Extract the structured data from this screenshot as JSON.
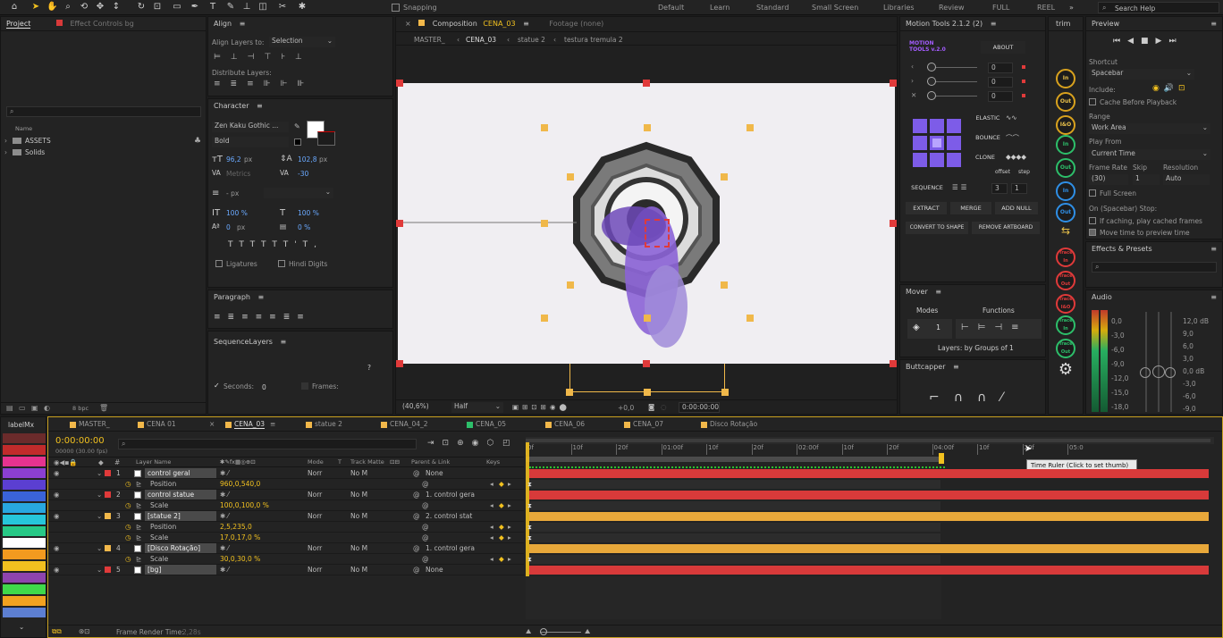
{
  "toolbar": {
    "snapping": "Snapping",
    "workspaces": [
      "Default",
      "Learn",
      "Standard",
      "Small Screen",
      "Libraries",
      "Review",
      "FULL",
      "REEL"
    ],
    "search": "Search Help"
  },
  "project": {
    "tab": "Project",
    "tab2": "Effect Controls bg",
    "col_name": "Name",
    "items": [
      "ASSETS",
      "Solids"
    ],
    "bpc": "8 bpc"
  },
  "align": {
    "title": "Align",
    "align_to_label": "Align Layers to:",
    "align_to_value": "Selection",
    "distribute": "Distribute Layers:"
  },
  "character": {
    "title": "Character",
    "font": "Zen Kaku Gothic ...",
    "style": "Bold",
    "size": "96,2",
    "size_unit": "px",
    "leading": "102,8",
    "leading_unit": "px",
    "kerning": "Metrics",
    "tracking": "-30",
    "stroke": "- px",
    "vscale": "100 %",
    "hscale": "100 %",
    "baseline": "0",
    "baseline_unit": "px",
    "tsume": "0 %",
    "ligatures": "Ligatures",
    "hindi": "Hindi Digits"
  },
  "paragraph": {
    "title": "Paragraph"
  },
  "sequence": {
    "title": "SequenceLayers",
    "seconds": "Seconds:",
    "seconds_value": "0",
    "frames": "Frames:",
    "help": "?"
  },
  "composition": {
    "tab": "Composition",
    "name": "CENA_03",
    "footage": "Footage (none)",
    "crumbs": [
      "MASTER_",
      "CENA_03",
      "statue 2",
      "testura tremula 2"
    ],
    "zoom": "(40,6%)",
    "res": "Half",
    "exposure": "+0,0",
    "time": "0:00:00:00"
  },
  "motion_tools": {
    "title": "Motion Tools 2.1.2 (2)",
    "logo": "MOTION TOOLS v.2.0",
    "about": "ABOUT",
    "fields": [
      "0",
      "0",
      "0"
    ],
    "elastic": "ELASTIC",
    "bounce": "BOUNCE",
    "clone": "CLONE",
    "offset": "offset",
    "step": "step",
    "sequence": "SEQUENCE",
    "seq_vals": [
      "3",
      "1"
    ],
    "extract": "EXTRACT",
    "merge": "MERGE",
    "add_null": "ADD NULL",
    "convert": "CONVERT TO SHAPE",
    "remove": "REMOVE ARTBOARD"
  },
  "mover": {
    "title": "Mover",
    "modes": "Modes",
    "functions": "Functions",
    "mode_value": "1",
    "status": "Layers: by Groups of 1"
  },
  "buttcapper": {
    "title": "Buttcapper"
  },
  "trim": {
    "title": "trim",
    "buttons": [
      "In",
      "Out",
      "I&O",
      "In",
      "Out",
      "In",
      "Out",
      "Trace In",
      "Trace Out",
      "Trace I&O",
      "Trace In",
      "Trace Out"
    ]
  },
  "preview": {
    "title": "Preview",
    "shortcut_label": "Shortcut",
    "shortcut": "Spacebar",
    "include": "Include:",
    "cache": "Cache Before Playback",
    "range_label": "Range",
    "range": "Work Area",
    "play_from_label": "Play From",
    "play_from": "Current Time",
    "frame_rate": "Frame Rate",
    "skip": "Skip",
    "resolution": "Resolution",
    "fr_value": "(30)",
    "skip_value": "1",
    "res_value": "Auto",
    "full_screen": "Full Screen",
    "stop_label": "On (Spacebar) Stop:",
    "if_caching": "If caching, play cached frames",
    "move_time": "Move time to preview time"
  },
  "effects": {
    "title": "Effects & Presets"
  },
  "audio": {
    "title": "Audio",
    "left": [
      "0,0",
      "-3,0",
      "-6,0",
      "-9,0",
      "-12,0",
      "-15,0",
      "-18,0"
    ],
    "right": [
      "12,0 dB",
      "9,0",
      "6,0",
      "3,0",
      "0,0 dB",
      "-3,0",
      "-6,0",
      "-9,0"
    ]
  },
  "timeline": {
    "label_panel": "labelMx",
    "tabs": [
      "MASTER_",
      "CENA 01",
      "CENA_03",
      "statue 2",
      "CENA_04_2",
      "CENA_05",
      "CENA_06",
      "CENA_07",
      "Disco Rotação"
    ],
    "time": "0:00:00:00",
    "fps": "00000 (30.00 fps)",
    "col_layer": "Layer Name",
    "col_mode": "Mode",
    "col_t": "T",
    "col_track": "Track Matte",
    "col_parent": "Parent & Link",
    "col_keys": "Keys",
    "ruler": [
      "0f",
      "10f",
      "20f",
      "01:00f",
      "10f",
      "20f",
      "02:00f",
      "10f",
      "20f",
      "04:00f",
      "10f",
      "20f",
      "05:0"
    ],
    "tooltip": "Time Ruler (Click to set thumb)",
    "render_time": "Frame Render Time:",
    "render_value": "2,28s",
    "layers": [
      {
        "num": "1",
        "name": "control geral",
        "mode": "Norr",
        "track": "No M",
        "parent": "None",
        "prop": "Position",
        "prop_val": "960,0,540,0"
      },
      {
        "num": "2",
        "name": "control statue",
        "mode": "Norr",
        "track": "No M",
        "parent": "1. control gera",
        "prop": "Scale",
        "prop_val": "100,0,100,0 %"
      },
      {
        "num": "3",
        "name": "[statue 2]",
        "mode": "Norr",
        "track": "No M",
        "parent": "2. control stat",
        "prop": "Position",
        "prop_val": "2,5,235,0",
        "prop2": "Scale",
        "prop2_val": "17,0,17,0 %"
      },
      {
        "num": "4",
        "name": "[Disco Rotação]",
        "mode": "Norr",
        "track": "No M",
        "parent": "1. control gera",
        "prop": "Scale",
        "prop_val": "30,0,30,0 %"
      },
      {
        "num": "5",
        "name": "[bg]",
        "mode": "Norr",
        "track": "No M",
        "parent": "None"
      }
    ],
    "swatch_colors": [
      "#6b2b2b",
      "#c12b2b",
      "#e6338f",
      "#8b3fd1",
      "#5b3fd1",
      "#3a63d9",
      "#28a7e0",
      "#26c6da",
      "#27c986",
      "#ffffff",
      "#f29a1f",
      "#f2c11f",
      "#8e44ad",
      "#3fd94a",
      "#f2a21f",
      "#5d7fd1"
    ]
  }
}
